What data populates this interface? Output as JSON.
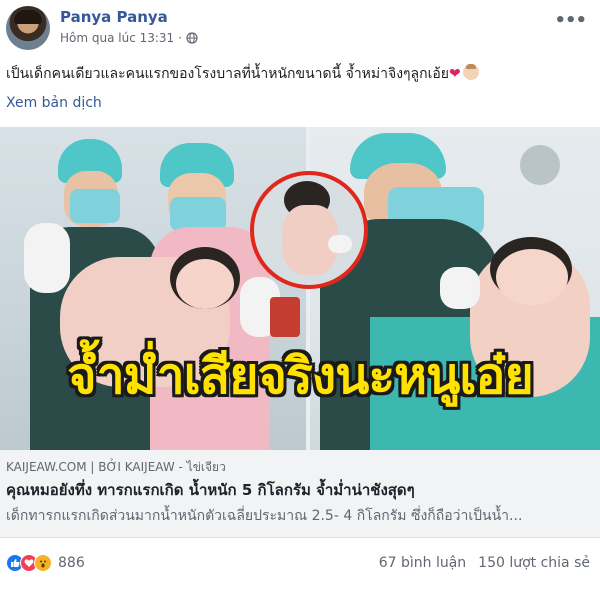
{
  "post": {
    "author": "Panya Panya",
    "time": "Hôm qua lúc 13:31",
    "separator": "·",
    "text": "เป็นเด็กคนเดียวและคนแรกของโรงบาลที่น้ำหนักขนาดนี้ จ้ำหม่าจิงๆลูกเอ้ย",
    "heart": "❤",
    "translate_label": "Xem bản dịch"
  },
  "image": {
    "overlay_text": "จ้ำม่ำเสียจริงนะหนูเอ๋ย"
  },
  "link": {
    "source": "KAIJEAW.COM | BỞI KAIJEAW - ไข่เจียว",
    "title": "คุณหมอยังทึ่ง ทารกแรกเกิด น้ำหนัก 5 กิโลกรัม จ้ำม่ำน่าชังสุดๆ",
    "description": "เด็กทารกแรกเกิดส่วนมากน้ำหนักตัวเฉลี่ยประมาณ 2.5- 4 กิโลกรัม ซึ่งก็ถือว่าเป็นน้ำ..."
  },
  "footer": {
    "reaction_count": "886",
    "comments": "67 bình luận",
    "shares": "150 lượt chia sẻ"
  },
  "colors": {
    "link_blue": "#365899",
    "like_blue": "#1877f2",
    "love_red": "#f33e58",
    "wow_yellow": "#f7b125",
    "overlay_yellow": "#ffe200",
    "inset_border_red": "#e1261c"
  },
  "icons": {
    "globe": "globe-icon",
    "more": "more-options-icon",
    "like": "like-reaction-icon",
    "love": "love-reaction-icon",
    "wow": "wow-reaction-icon"
  }
}
